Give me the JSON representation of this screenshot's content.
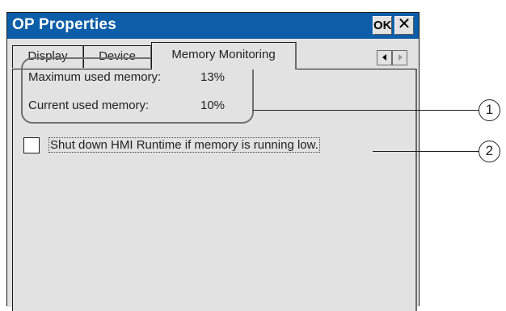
{
  "window": {
    "title": "OP Properties",
    "ok_label": "OK",
    "close_label": "✕"
  },
  "tabs": [
    {
      "label": "Display"
    },
    {
      "label": "Device"
    },
    {
      "label": "Memory Monitoring",
      "active": true
    }
  ],
  "memory": {
    "max_label": "Maximum used memory:",
    "max_value": "13%",
    "current_label": "Current used memory:",
    "current_value": "10%"
  },
  "shutdown_option": {
    "label": "Shut down HMI Runtime if memory is running low.",
    "checked": false
  },
  "callouts": [
    "1",
    "2"
  ],
  "colors": {
    "titlebar": "#0d5ea8",
    "window_bg": "#e2e2e2"
  }
}
